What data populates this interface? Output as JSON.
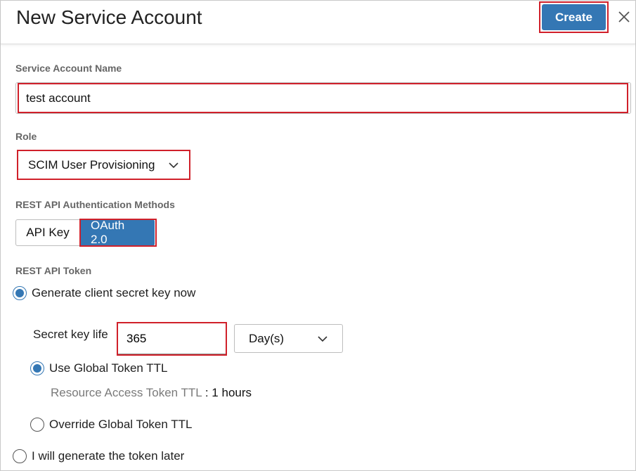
{
  "dialog": {
    "title": "New Service Account",
    "create_label": "Create",
    "close_icon": "close-icon"
  },
  "fields": {
    "name": {
      "label": "Service Account Name",
      "value": "test account"
    },
    "role": {
      "label": "Role",
      "value": "SCIM User Provisioning"
    },
    "auth_methods": {
      "label": "REST API Authentication Methods",
      "options": [
        "API Key",
        "OAuth 2.0"
      ],
      "selected": "OAuth 2.0"
    },
    "token": {
      "label": "REST API Token",
      "generate_now": "Generate client secret key now",
      "secret_key_life_label": "Secret key life",
      "secret_key_life_value": "365",
      "unit": "Day(s)",
      "use_global": "Use Global Token TTL",
      "resource_ttl_label": "Resource Access Token TTL",
      "resource_ttl_value": ": 1 hours",
      "override_global": "Override Global Token TTL",
      "generate_later": "I will generate the token later"
    }
  },
  "colors": {
    "accent": "#3477b4",
    "highlight": "#d0202a"
  }
}
